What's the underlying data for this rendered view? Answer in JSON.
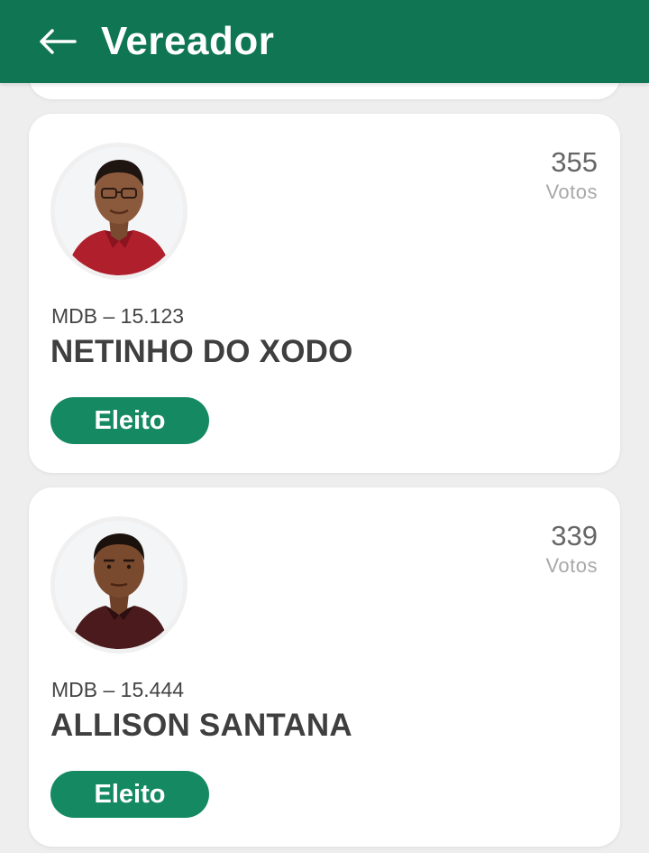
{
  "header": {
    "title": "Vereador",
    "back_icon": "arrow-left-icon",
    "background": "#0f7553"
  },
  "candidates": [
    {
      "party_number": "MDB – 15.123",
      "name": "NETINHO DO XODO",
      "votes": "355",
      "votes_label": "Votos",
      "status": "Eleito"
    },
    {
      "party_number": "MDB – 15.444",
      "name": "ALLISON SANTANA",
      "votes": "339",
      "votes_label": "Votos",
      "status": "Eleito"
    }
  ],
  "colors": {
    "status_badge": "#158a62",
    "page_background": "#eeeeee",
    "card_background": "#ffffff"
  }
}
